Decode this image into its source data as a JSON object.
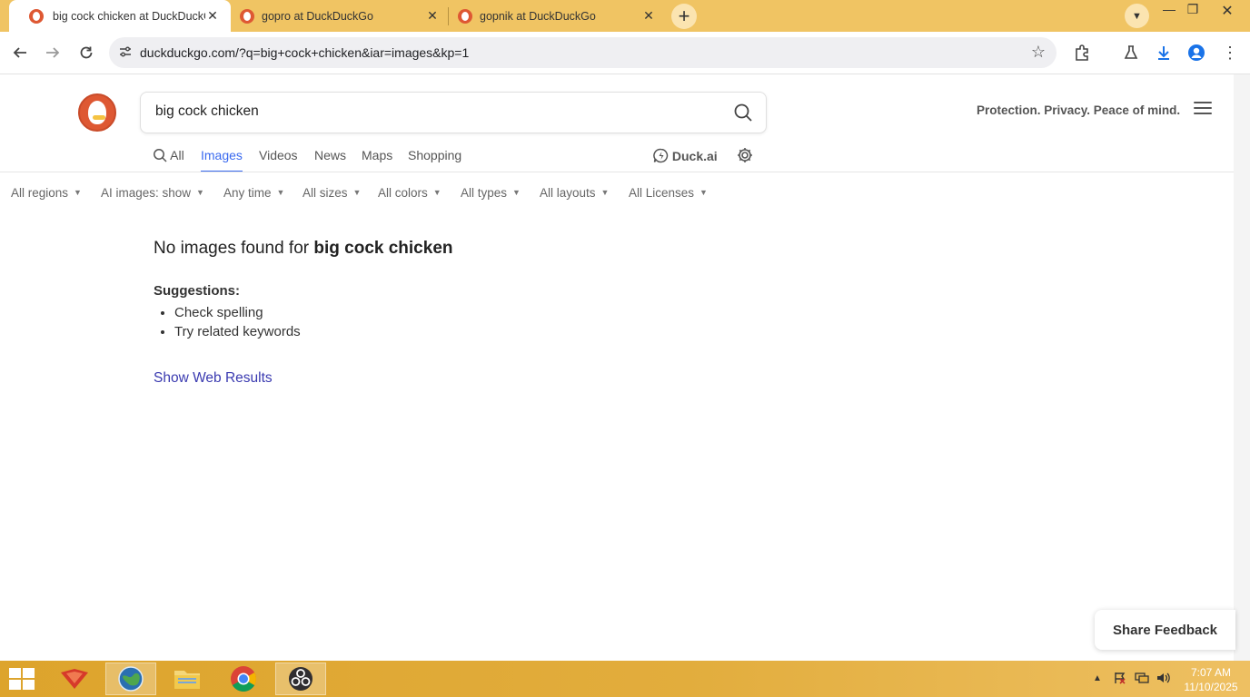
{
  "browser": {
    "tabs": [
      {
        "title": "big cock chicken at DuckDuckGo",
        "active": true
      },
      {
        "title": "gopro at DuckDuckGo",
        "active": false
      },
      {
        "title": "gopnik at DuckDuckGo",
        "active": false
      }
    ],
    "url": "duckduckgo.com/?q=big+cock+chicken&iar=images&kp=1"
  },
  "search": {
    "query": "big cock chicken"
  },
  "header": {
    "tagline": "Protection. Privacy. Peace of mind."
  },
  "nav": {
    "all": "All",
    "images": "Images",
    "videos": "Videos",
    "news": "News",
    "maps": "Maps",
    "shopping": "Shopping",
    "duckai": "Duck.ai"
  },
  "filters": [
    "All regions",
    "AI images: show",
    "Any time",
    "All sizes",
    "All colors",
    "All types",
    "All layouts",
    "All Licenses"
  ],
  "results": {
    "no_images_prefix": "No images found for",
    "no_images_query": "big cock chicken",
    "suggestions_title": "Suggestions:",
    "suggestions": [
      "Check spelling",
      "Try related keywords"
    ],
    "show_web_results": "Show Web Results"
  },
  "feedback": {
    "label": "Share Feedback"
  },
  "taskbar": {
    "time": "7:07 AM",
    "date": "11/10/2025"
  },
  "colors": {
    "accent": "#3969ef",
    "ddg_orange": "#de5833",
    "tabstrip": "#f0c463",
    "taskbar": "#dda42c"
  }
}
